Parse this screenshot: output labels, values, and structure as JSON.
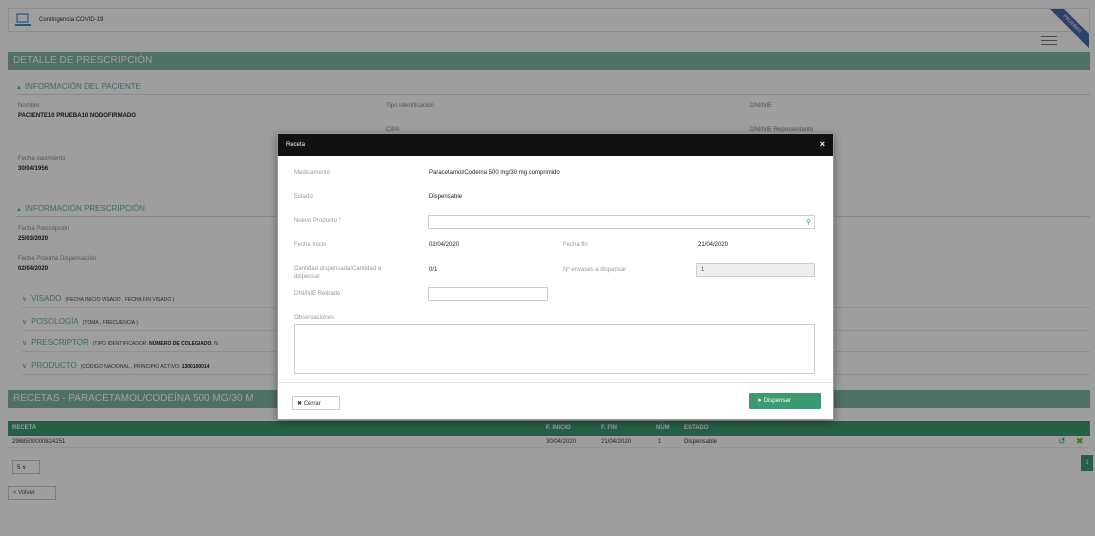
{
  "topbar": {
    "app_title": "Contingencia COVID-19",
    "ribbon": "PRUEBAS"
  },
  "main": {
    "title": "DETALLE DE PRESCRIPCIÓN",
    "paciente": {
      "section": "INFORMACIÓN DEL PACIENTE",
      "nombre_label": "Nombre",
      "nombre_value": "PACIENTE10 PRUEBA10 NODOFIRMADO",
      "tipo_id_label": "Tipo identificación",
      "dnimie_label": "DNI/NIE",
      "cipa_label": "CIPA",
      "dni_rep_label": "DNI/NIE Representante",
      "fnac_label": "Fecha nacimiento",
      "fnac_value": "30/04/1956"
    },
    "prescripcion": {
      "section": "INFORMACIÓN PRESCRIPCIÓN",
      "fpresc_label": "Fecha Prescripción",
      "fpresc_value": "25/03/2020",
      "fprox_label": "Fecha Próxima Dispensación",
      "fprox_value": "02/04/2020"
    },
    "collapsibles": [
      {
        "title": "VISADO",
        "sub": "(FECHA INICIO VISADO , FECHA FIN VISADO )"
      },
      {
        "title": "POSOLOGÍA",
        "sub": "(TOMA , FRECUENCIA )"
      },
      {
        "title": "PRESCRIPTOR",
        "sub": "(TIPO IDENTIFICADOR:",
        "sub_bold": "NÚMERO DE COLEGIADO",
        "sub_tail": ", N"
      },
      {
        "title": "PRODUCTO",
        "sub": "(CÓDIGO NACIONAL , PRINCIPIO ACTIVO:",
        "sub_bold": "1300100014"
      }
    ],
    "recetas_title": "RECETAS - PARACETAMOL/CODEÍNA 500 MG/30 M"
  },
  "table": {
    "headers": [
      "RECETA",
      "F. INICIO",
      "F. FIN",
      "NÚM",
      "ESTADO"
    ],
    "rows": [
      {
        "receta": "2988500000824251",
        "finicio": "30/04/2020",
        "ffin": "21/04/2020",
        "num": "1",
        "estado": "Dispensable"
      }
    ],
    "page_size": "5",
    "pager": "1"
  },
  "buttons": {
    "volver": "< Volver"
  },
  "modal": {
    "title": "Receta",
    "medicamento_label": "Medicamento",
    "medicamento_value": "Paracetamol/Codeína 500 mg/30 mg comprimido",
    "estado_label": "Estado",
    "estado_value": "Dispensable",
    "nuevo_producto_label": "Nuevo Producto *",
    "fecha_inicio_label": "Fecha Inicio",
    "fecha_inicio_value": "02/04/2020",
    "fecha_fin_label": "Fecha fin",
    "fecha_fin_value": "21/04/2020",
    "cantidad_label": "Cantidad dispensada/Cantidad a dispensar",
    "cantidad_value": "0/1",
    "envases_label": "Nº envases a dispensar",
    "envases_value": "1",
    "dni_retirado_label": "DNI/NIE Retirado",
    "observaciones_label": "Observaciones",
    "cerrar": "Cerrar",
    "dispensar": "Dispensar"
  },
  "colors": {
    "header_green": "#7fb7a0",
    "table_green": "#3c9a72",
    "modal_head": "#111111"
  }
}
